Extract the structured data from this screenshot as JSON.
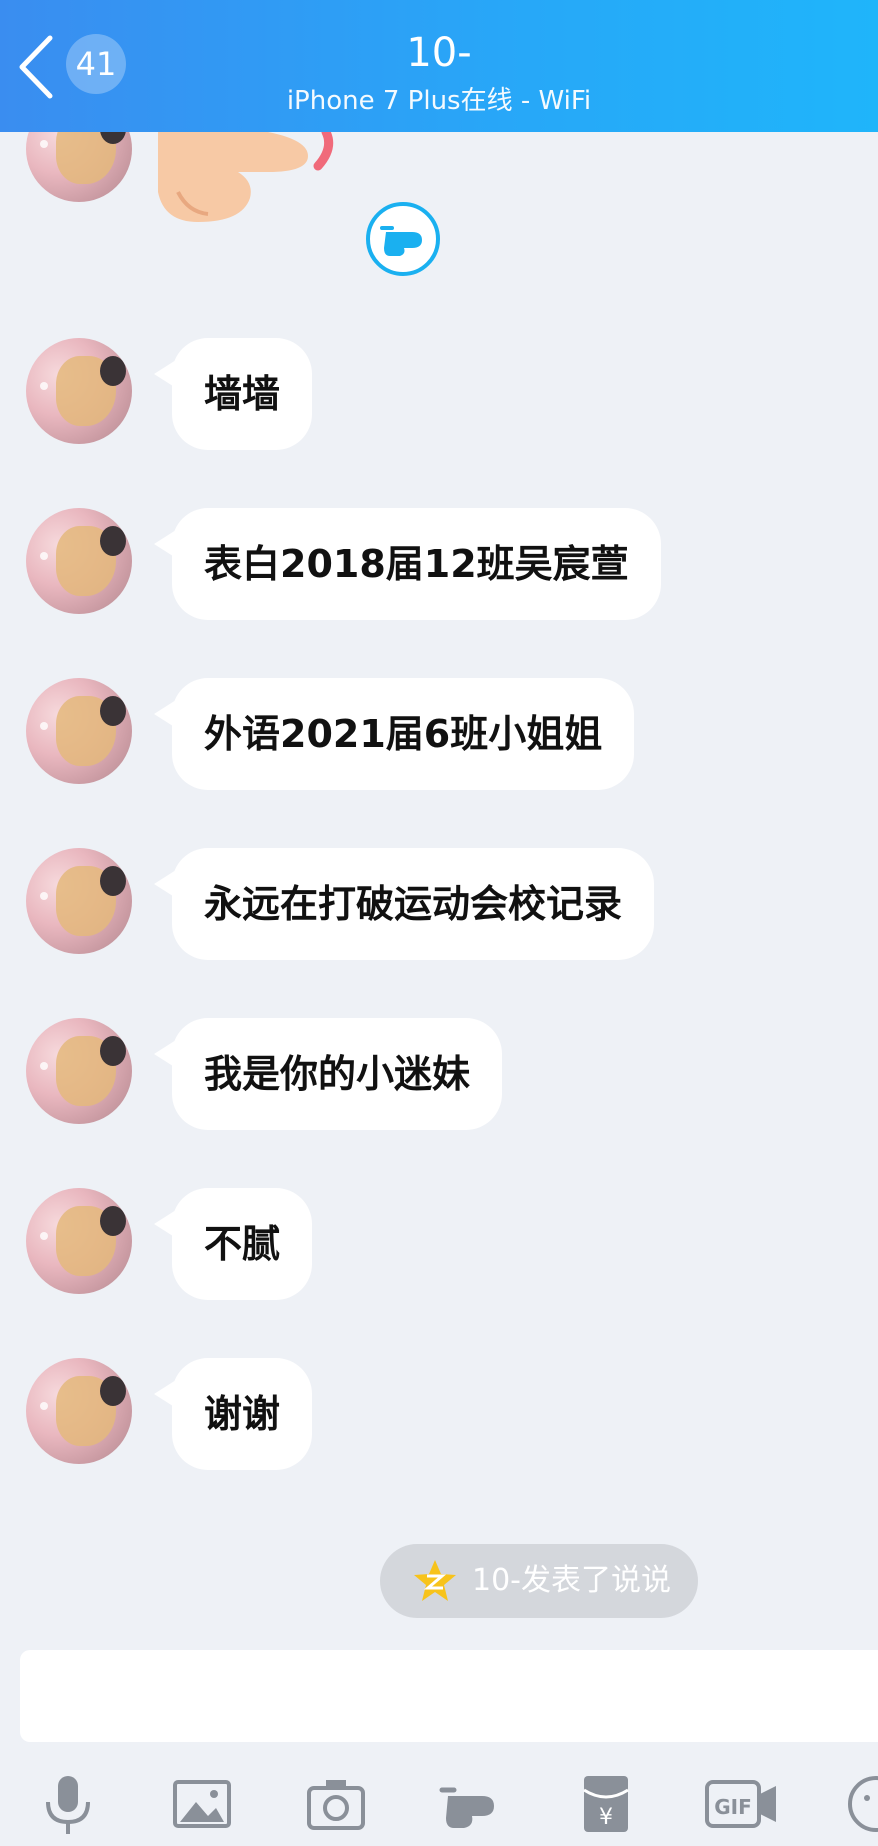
{
  "header": {
    "unread_count": "41",
    "contact_name": "10-",
    "status": "iPhone 7 Plus在线 - WiFi"
  },
  "messages": [
    {
      "text": "墙墙"
    },
    {
      "text": "表白2018届12班吴宸萱"
    },
    {
      "text": "外语2021届6班小姐姐"
    },
    {
      "text": "永远在打破运动会校记录"
    },
    {
      "text": "我是你的小迷妹"
    },
    {
      "text": "不腻"
    },
    {
      "text": "谢谢"
    }
  ],
  "notice": {
    "text": "10-发表了说说",
    "icon": "qzone-star-icon"
  },
  "input": {
    "placeholder": ""
  },
  "toolbar": {
    "icons": [
      "microphone-icon",
      "image-icon",
      "camera-icon",
      "poke-hand-icon",
      "red-packet-icon",
      "gif-icon",
      "emoji-icon"
    ]
  },
  "colors": {
    "header_start": "#3a8df0",
    "header_end": "#1fb5fa",
    "background": "#eef1f6",
    "bubble": "#ffffff"
  }
}
